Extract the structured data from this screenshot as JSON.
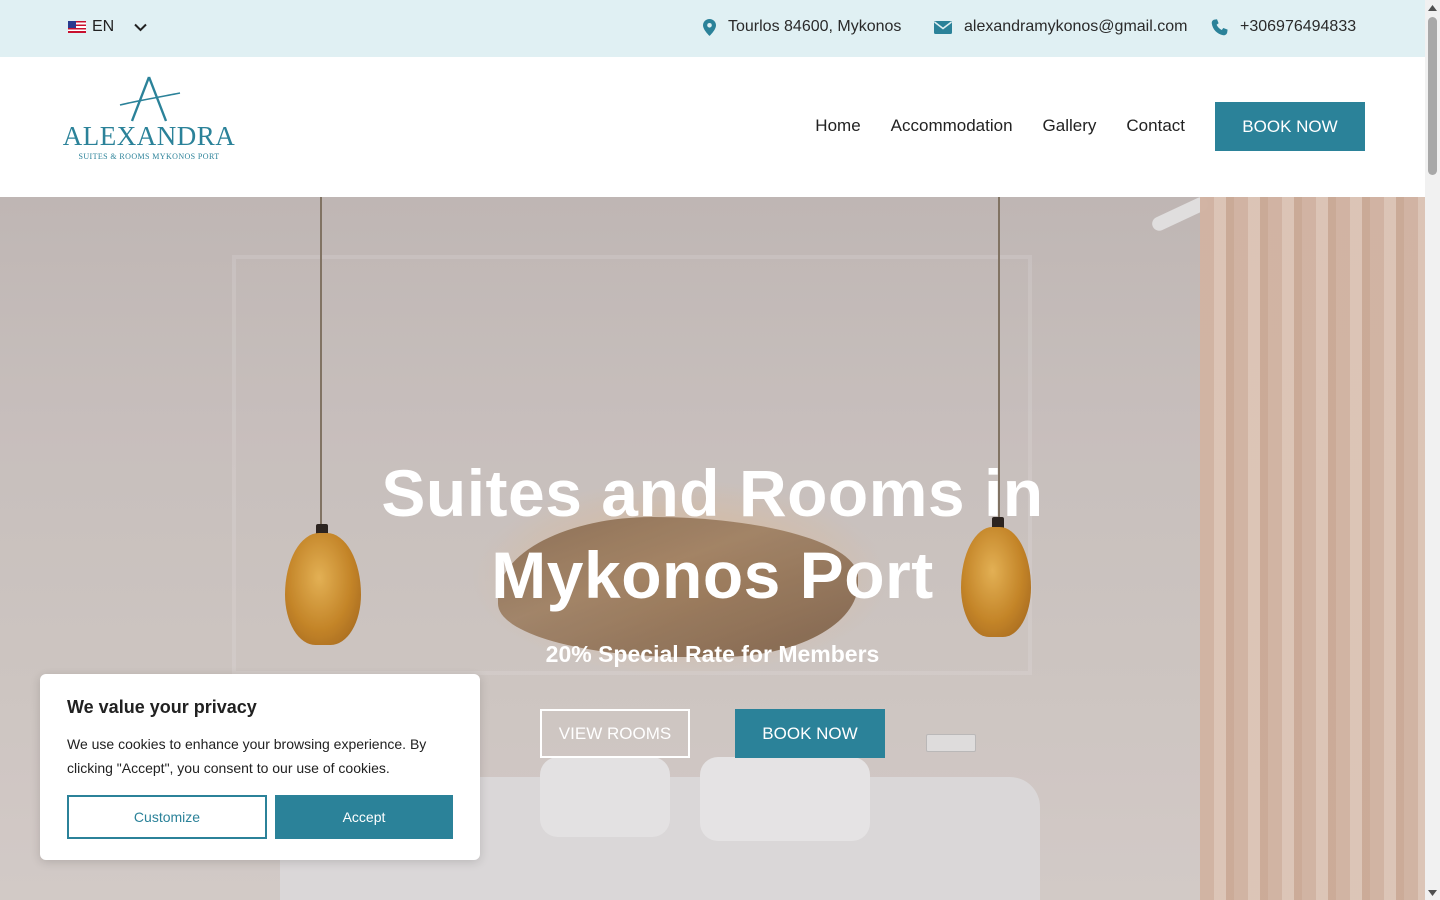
{
  "colors": {
    "accent": "#2b8299",
    "topbar_bg": "#e0f0f3"
  },
  "topbar": {
    "language": {
      "code": "EN",
      "flag_icon": "us-flag-icon"
    },
    "address": {
      "icon": "map-pin-icon",
      "text": "Tourlos 84600, Mykonos"
    },
    "email": {
      "icon": "envelope-icon",
      "text": "alexandramykonos@gmail.com"
    },
    "phone": {
      "icon": "phone-icon",
      "text": "+306976494833"
    }
  },
  "header": {
    "logo": {
      "letter": "A",
      "name": "ALEXANDRA",
      "tagline": "SUITES & ROOMS MYKONOS PORT"
    },
    "nav": [
      "Home",
      "Accommodation",
      "Gallery",
      "Contact"
    ],
    "book_label": "BOOK NOW"
  },
  "hero": {
    "title": "Suites and Rooms in Mykonos Port",
    "subtitle": "20% Special Rate for Members",
    "view_rooms_label": "VIEW ROOMS",
    "book_label": "BOOK NOW"
  },
  "cookie_banner": {
    "title": "We value your privacy",
    "text": "We use cookies to enhance your browsing experience. By clicking \"Accept\", you consent to our use of cookies.",
    "customize_label": "Customize",
    "accept_label": "Accept"
  }
}
